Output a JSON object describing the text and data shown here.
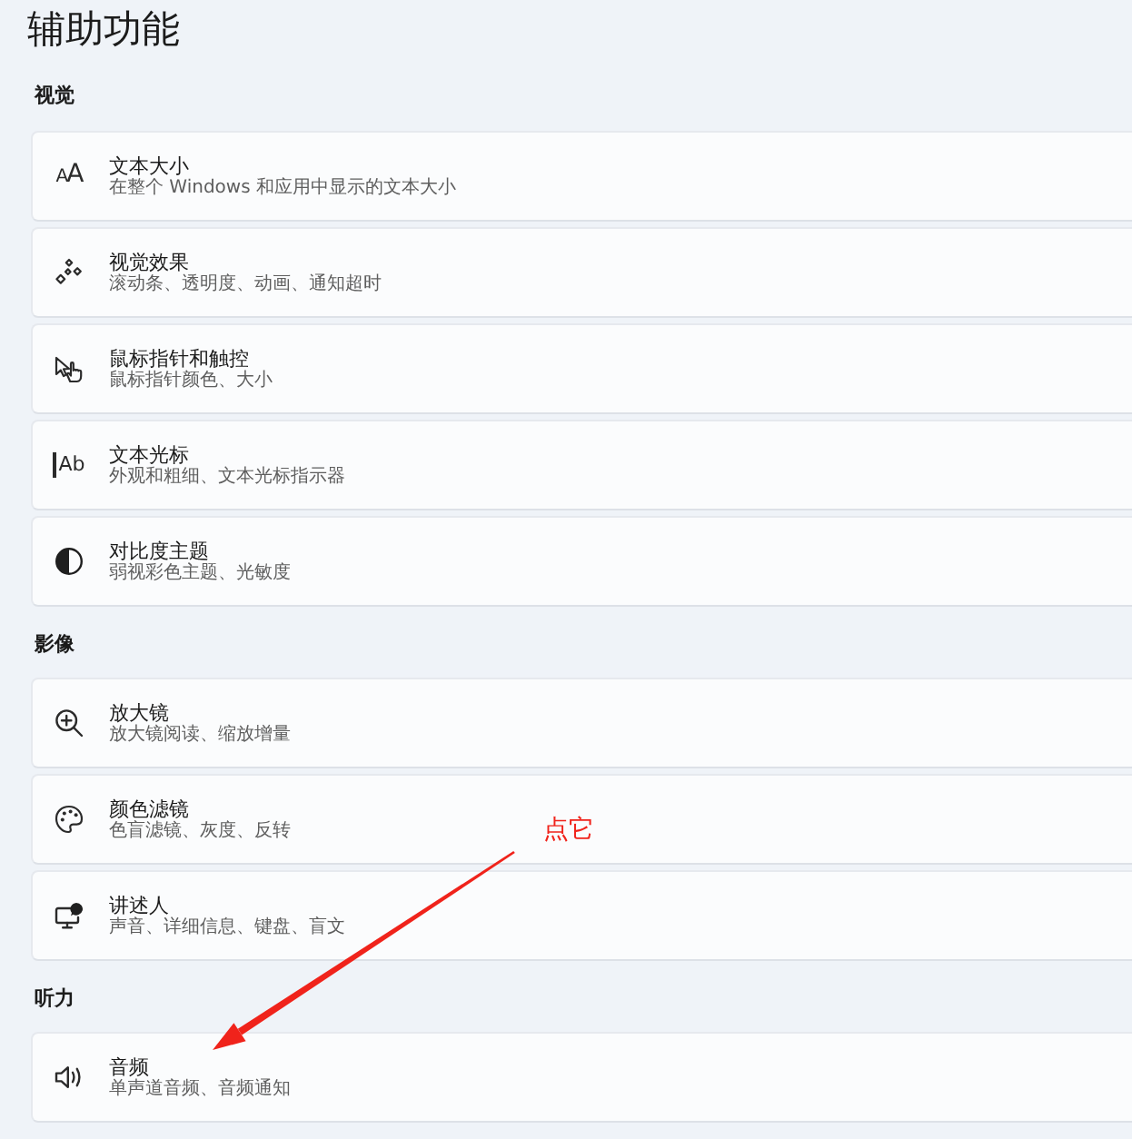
{
  "page": {
    "title": "辅助功能"
  },
  "sections": [
    {
      "heading": "视觉",
      "items": [
        {
          "kind": "textsize",
          "glyph": "AA",
          "title": "文本大小",
          "description": "在整个 Windows 和应用中显示的文本大小"
        },
        {
          "kind": "effects",
          "title": "视觉效果",
          "description": "滚动条、透明度、动画、通知超时"
        },
        {
          "kind": "pointer",
          "title": "鼠标指针和触控",
          "description": "鼠标指针颜色、大小"
        },
        {
          "kind": "cursor",
          "glyph": "Ab",
          "title": "文本光标",
          "description": "外观和粗细、文本光标指示器"
        },
        {
          "kind": "contrast",
          "title": "对比度主题",
          "description": "弱视彩色主题、光敏度"
        }
      ]
    },
    {
      "heading": "影像",
      "items": [
        {
          "kind": "magnifier",
          "title": "放大镜",
          "description": "放大镜阅读、缩放增量"
        },
        {
          "kind": "filters",
          "title": "颜色滤镜",
          "description": "色盲滤镜、灰度、反转"
        },
        {
          "kind": "narrator",
          "title": "讲述人",
          "description": "声音、详细信息、键盘、盲文"
        }
      ]
    },
    {
      "heading": "听力",
      "items": [
        {
          "kind": "audio",
          "title": "音频",
          "description": "单声道音频、音频通知"
        }
      ]
    }
  ],
  "annotation": {
    "text": "点它"
  }
}
